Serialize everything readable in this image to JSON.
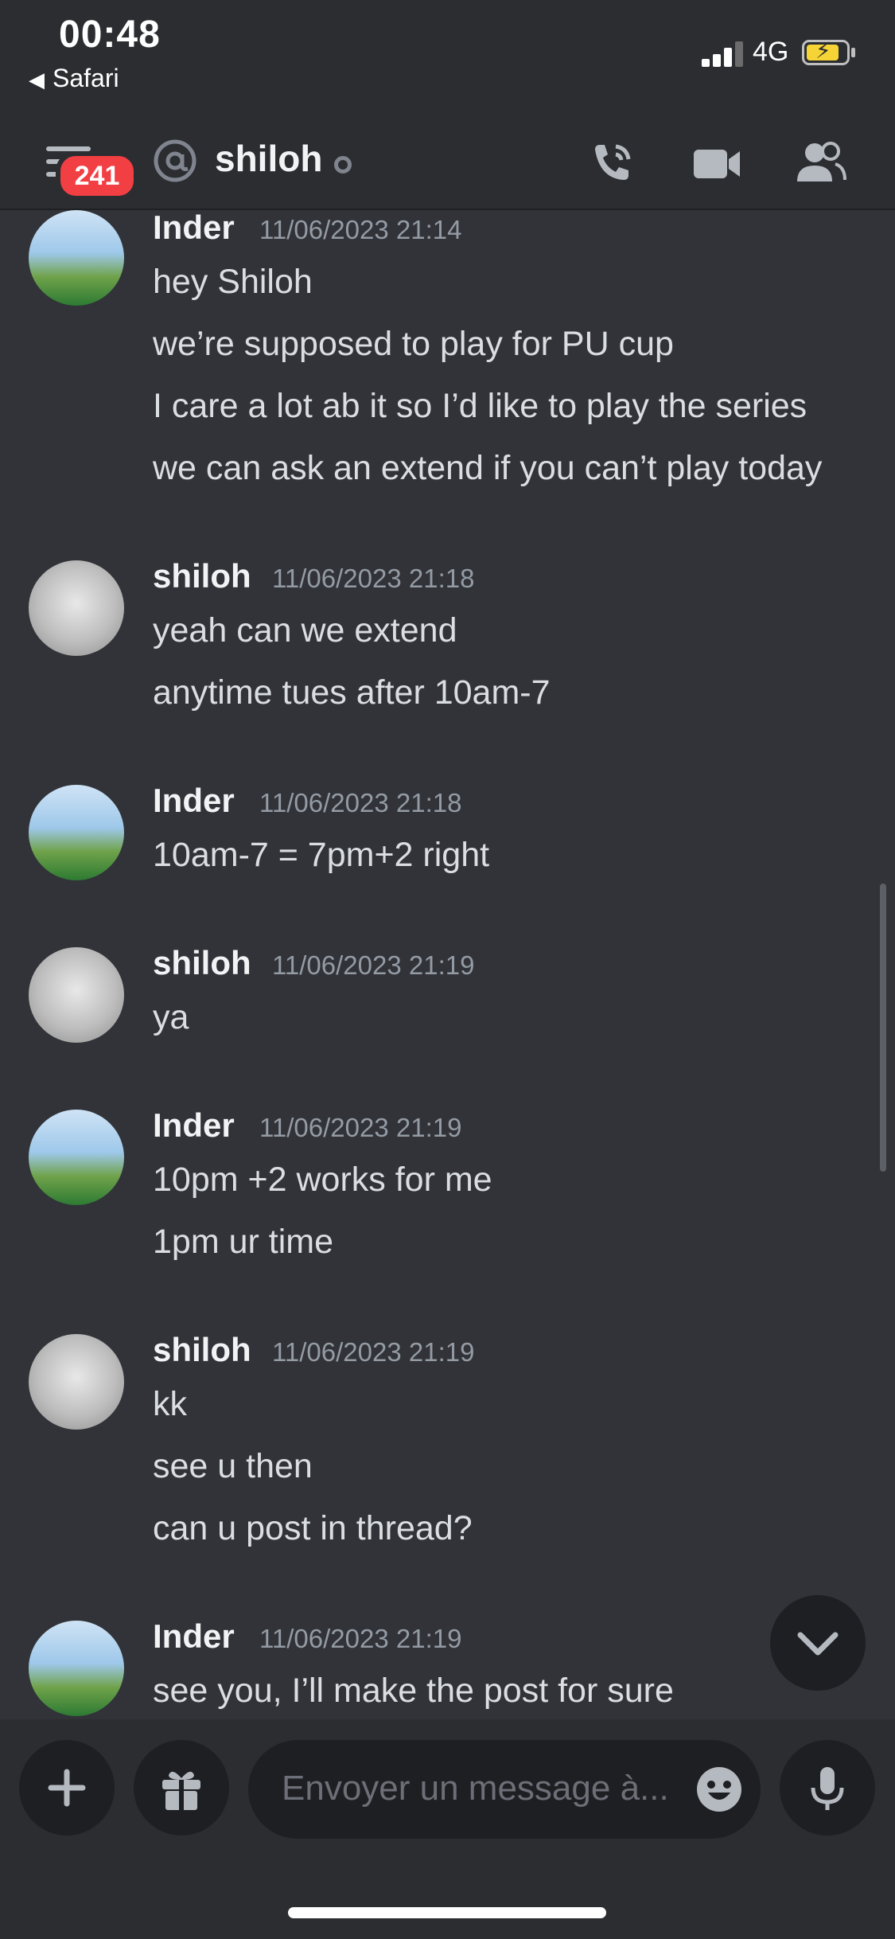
{
  "status_bar": {
    "time": "00:48",
    "back_app": "Safari",
    "network": "4G",
    "battery_charging": true
  },
  "header": {
    "unread_count": "241",
    "channel_name": "shiloh",
    "presence": "offline",
    "icons": [
      "menu-icon",
      "at-icon",
      "phone-call-icon",
      "video-camera-icon",
      "members-icon"
    ]
  },
  "messages": [
    {
      "author": "Inder",
      "timestamp": "11/06/2023 21:14",
      "lines": [
        "hey Shiloh",
        "we’re supposed to play for PU cup",
        "I care a lot ab it so I’d like to play the series",
        "we can ask an extend if you can’t play today"
      ]
    },
    {
      "author": "shiloh",
      "timestamp": "11/06/2023 21:18",
      "lines": [
        "yeah can we extend",
        "anytime tues after 10am-7"
      ]
    },
    {
      "author": "Inder",
      "timestamp": "11/06/2023 21:18",
      "lines": [
        "10am-7 = 7pm+2 right"
      ]
    },
    {
      "author": "shiloh",
      "timestamp": "11/06/2023 21:19",
      "lines": [
        "ya"
      ]
    },
    {
      "author": "Inder",
      "timestamp": "11/06/2023 21:19",
      "lines": [
        "10pm +2 works for me",
        "1pm ur time"
      ]
    },
    {
      "author": "shiloh",
      "timestamp": "11/06/2023 21:19",
      "lines": [
        "kk",
        "see u then",
        "can u post in thread?"
      ]
    },
    {
      "author": "Inder",
      "timestamp": "11/06/2023 21:19",
      "lines": [
        "see you, I’ll make the post for sure"
      ]
    }
  ],
  "composer": {
    "placeholder": "Envoyer un message à..."
  },
  "colors": {
    "background": "#313338",
    "header": "#2b2d31",
    "badge": "#f23f43",
    "muted": "#949ba4"
  }
}
